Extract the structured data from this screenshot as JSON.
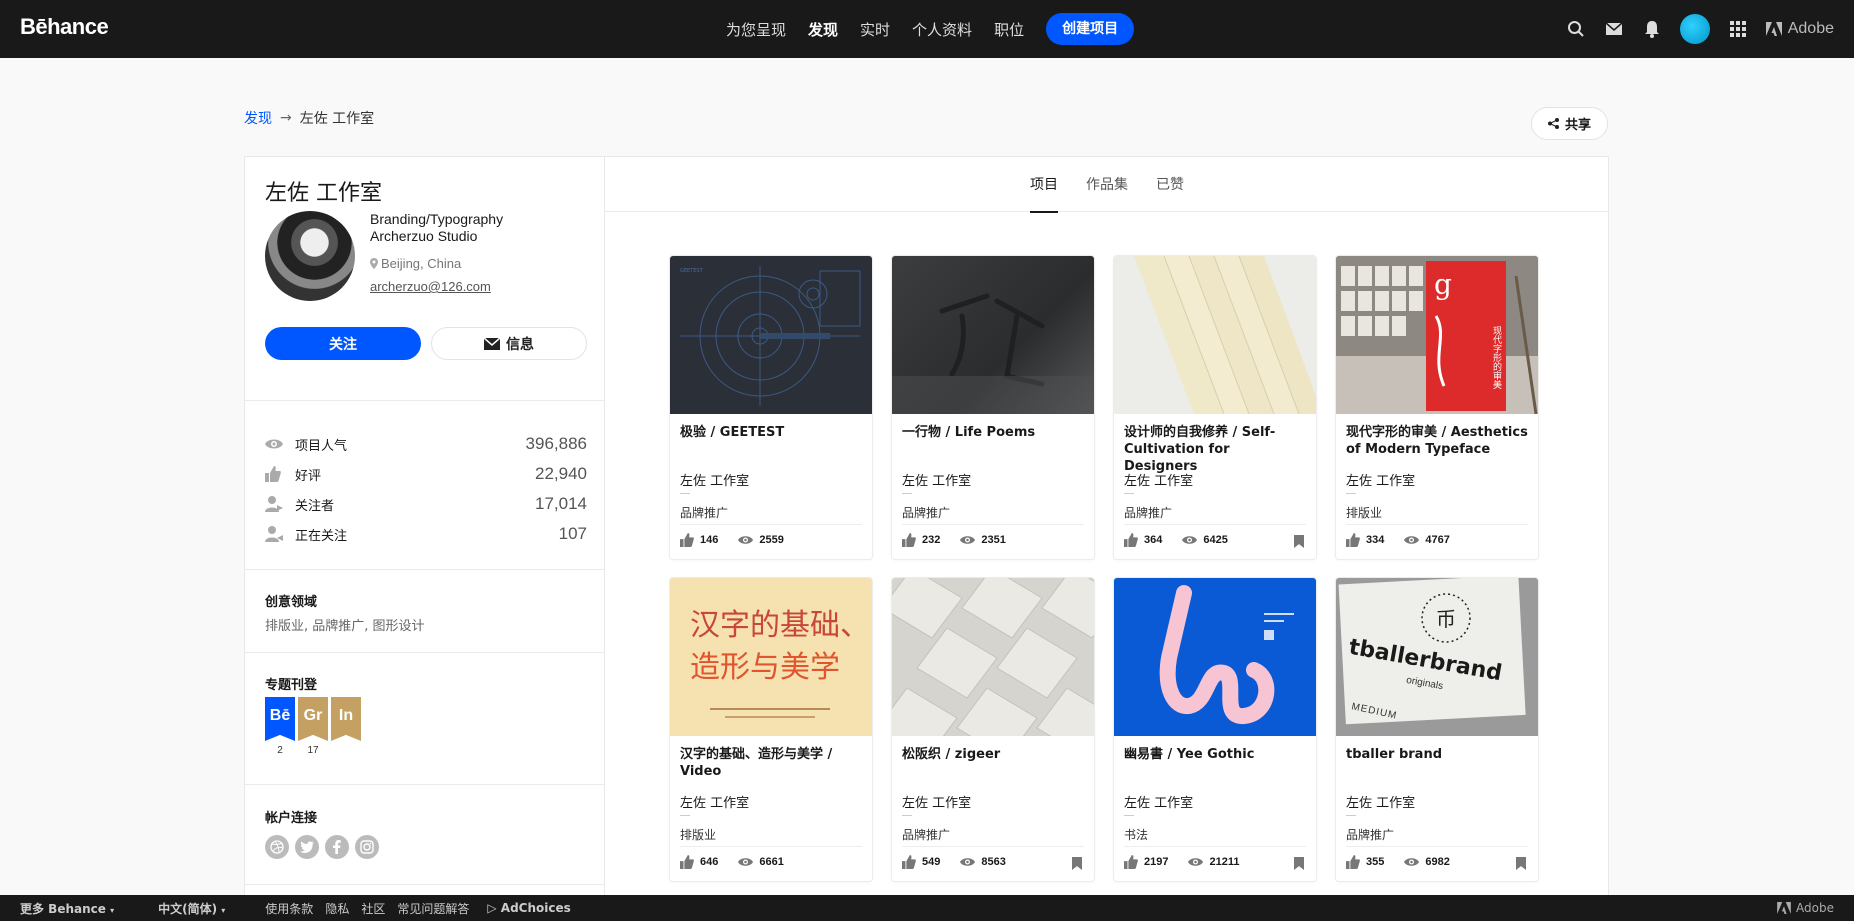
{
  "nav": {
    "logo": "Bēhance",
    "links": [
      "为您呈现",
      "发现",
      "实时",
      "个人资料",
      "职位"
    ],
    "active": "发现",
    "create": "创建项目",
    "adobe": "Adobe"
  },
  "breadcrumb": {
    "link": "发现",
    "arrow": "→",
    "current": "左佐 工作室"
  },
  "share": "共享",
  "profile": {
    "name": "左佐 工作室",
    "occupation": "Branding/Typography",
    "company": "Archerzuo Studio",
    "location": "Beijing, China",
    "email": "archerzuo@126.com",
    "follow": "关注",
    "message": "信息"
  },
  "stats": [
    {
      "icon": "eye-icon",
      "label": "项目人气",
      "value": "396,886"
    },
    {
      "icon": "thumbs-up-icon",
      "label": "好评",
      "value": "22,940"
    },
    {
      "icon": "follower-icon",
      "label": "关注者",
      "value": "17,014"
    },
    {
      "icon": "following-icon",
      "label": "正在关注",
      "value": "107"
    }
  ],
  "fields": {
    "title": "创意领域",
    "text": "排版业, 品牌推广, 图形设计"
  },
  "featured": {
    "title": "专题刊登",
    "badges": [
      {
        "label": "Bē",
        "count": "2",
        "color": "#0057ff"
      },
      {
        "label": "Gr",
        "count": "17",
        "color": "#c4a162"
      },
      {
        "label": "In",
        "count": "",
        "color": "#c4a162"
      }
    ]
  },
  "links_section": {
    "title": "帐户连接"
  },
  "tabs": [
    "项目",
    "作品集",
    "已赞"
  ],
  "projects": [
    {
      "title": "极验 / GEETEST",
      "owner": "左佐 工作室",
      "field": "品牌推广",
      "likes": "146",
      "views": "2559",
      "bookmark": false
    },
    {
      "title": "一行物 / Life Poems",
      "owner": "左佐 工作室",
      "field": "品牌推广",
      "likes": "232",
      "views": "2351",
      "bookmark": false
    },
    {
      "title": "设计师的自我修养 / Self-Cultivation for Designers",
      "owner": "左佐 工作室",
      "field": "品牌推广",
      "likes": "364",
      "views": "6425",
      "bookmark": true
    },
    {
      "title": "现代字形的审美 / Aesthetics of Modern Typeface",
      "owner": "左佐 工作室",
      "field": "排版业",
      "likes": "334",
      "views": "4767",
      "bookmark": false
    },
    {
      "title": "汉字的基础、造形与美学 / Video",
      "owner": "左佐 工作室",
      "field": "排版业",
      "likes": "646",
      "views": "6661",
      "bookmark": false
    },
    {
      "title": "松阪织 / zigeer",
      "owner": "左佐 工作室",
      "field": "品牌推广",
      "likes": "549",
      "views": "8563",
      "bookmark": true
    },
    {
      "title": "幽易書 / Yee Gothic",
      "owner": "左佐 工作室",
      "field": "书法",
      "likes": "2197",
      "views": "21211",
      "bookmark": true
    },
    {
      "title": "tballer brand",
      "owner": "左佐 工作室",
      "field": "品牌推广",
      "likes": "355",
      "views": "6982",
      "bookmark": true
    }
  ],
  "thumb_text": {
    "book": "汉字的基础、",
    "book2": "造形与美学",
    "tballer": "tballerbrand",
    "originals": "originals",
    "medium": "MEDIUM",
    "modern": "现代字形的审美"
  },
  "footer": {
    "more": "更多 Behance",
    "lang": "中文(简体)",
    "links": [
      "使用条款",
      "隐私",
      "社区",
      "常见问题解答"
    ],
    "adchoices": "AdChoices",
    "adobe": "Adobe"
  }
}
